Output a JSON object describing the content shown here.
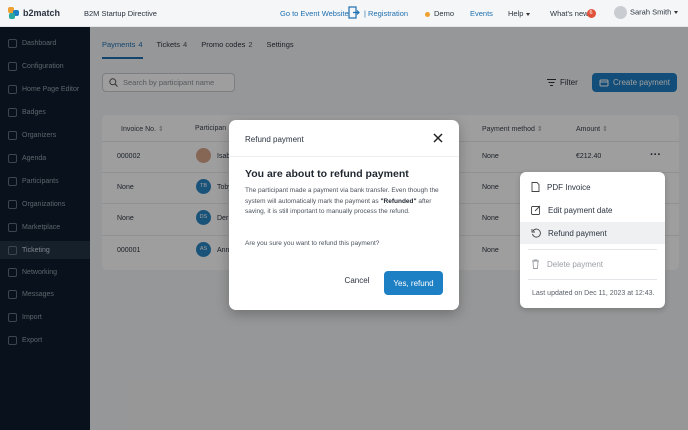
{
  "header": {
    "brand": "b2match",
    "event_title": "B2M Startup Directive",
    "go_to_event": "Go to Event Website",
    "registration": "| Registration",
    "demo": "Demo",
    "events": "Events",
    "help": "Help",
    "whats_new": "What's new",
    "whats_new_badge": "6",
    "user_name": "Sarah Smith"
  },
  "sidebar": {
    "items": [
      {
        "label": "Dashboard",
        "icon": "dashboard-icon"
      },
      {
        "label": "Configuration",
        "icon": "gear-icon"
      },
      {
        "label": "Home Page Editor",
        "icon": "page-editor-icon"
      },
      {
        "label": "Badges",
        "icon": "badge-icon"
      },
      {
        "label": "Organizers",
        "icon": "organizer-icon"
      },
      {
        "label": "Agenda",
        "icon": "calendar-icon"
      },
      {
        "label": "Participants",
        "icon": "participants-icon"
      },
      {
        "label": "Organizations",
        "icon": "building-icon"
      },
      {
        "label": "Marketplace",
        "icon": "marketplace-icon"
      },
      {
        "label": "Ticketing",
        "icon": "ticket-icon"
      },
      {
        "label": "Networking",
        "icon": "network-icon"
      },
      {
        "label": "Messages",
        "icon": "mail-icon"
      },
      {
        "label": "Import",
        "icon": "import-icon"
      },
      {
        "label": "Export",
        "icon": "export-icon"
      }
    ],
    "active": "Ticketing"
  },
  "tabs": [
    {
      "label": "Payments",
      "count": "4"
    },
    {
      "label": "Tickets",
      "count": "4"
    },
    {
      "label": "Promo codes",
      "count": "2"
    },
    {
      "label": "Settings",
      "count": ""
    }
  ],
  "toolbar": {
    "search_placeholder": "Search by participant name",
    "filter": "Filter",
    "create_payment": "Create payment"
  },
  "table": {
    "headers": {
      "invoice": "Invoice No.",
      "participant": "Participan",
      "method": "Payment method",
      "amount": "Amount"
    },
    "rows": [
      {
        "invoice": "000002",
        "participant": "Isab",
        "initials": "",
        "avatar_color": "#d9a58a",
        "method": "None",
        "amount": "€212.40"
      },
      {
        "invoice": "None",
        "participant": "Toby",
        "initials": "TB",
        "avatar_color": "#2a86c4",
        "method": "None",
        "amount": ""
      },
      {
        "invoice": "None",
        "participant": "Der",
        "initials": "DS",
        "avatar_color": "#2a86c4",
        "method": "None",
        "amount": ""
      },
      {
        "invoice": "000001",
        "participant": "Ann",
        "initials": "AS",
        "avatar_color": "#2a86c4",
        "method": "None",
        "amount": ""
      }
    ]
  },
  "context_menu": {
    "pdf_invoice": "PDF Invoice",
    "edit_date": "Edit payment date",
    "refund": "Refund payment",
    "delete": "Delete payment",
    "last_updated": "Last updated on Dec 11, 2023 at 12:43."
  },
  "modal": {
    "header": "Refund payment",
    "title": "You are about to refund payment",
    "body_1": "The participant made a payment via bank transfer. Even though the system will automatically mark the payment as",
    "body_bold": "\"Refunded\"",
    "body_2": " after saving, it is still important to manually process the refund.",
    "question": "Are you sure you want to refund this payment?",
    "cancel": "Cancel",
    "confirm": "Yes, refund"
  },
  "colors": {
    "accent": "#1d7fc4",
    "sidebar_bg": "#0b1621",
    "badge": "#e0533a"
  }
}
